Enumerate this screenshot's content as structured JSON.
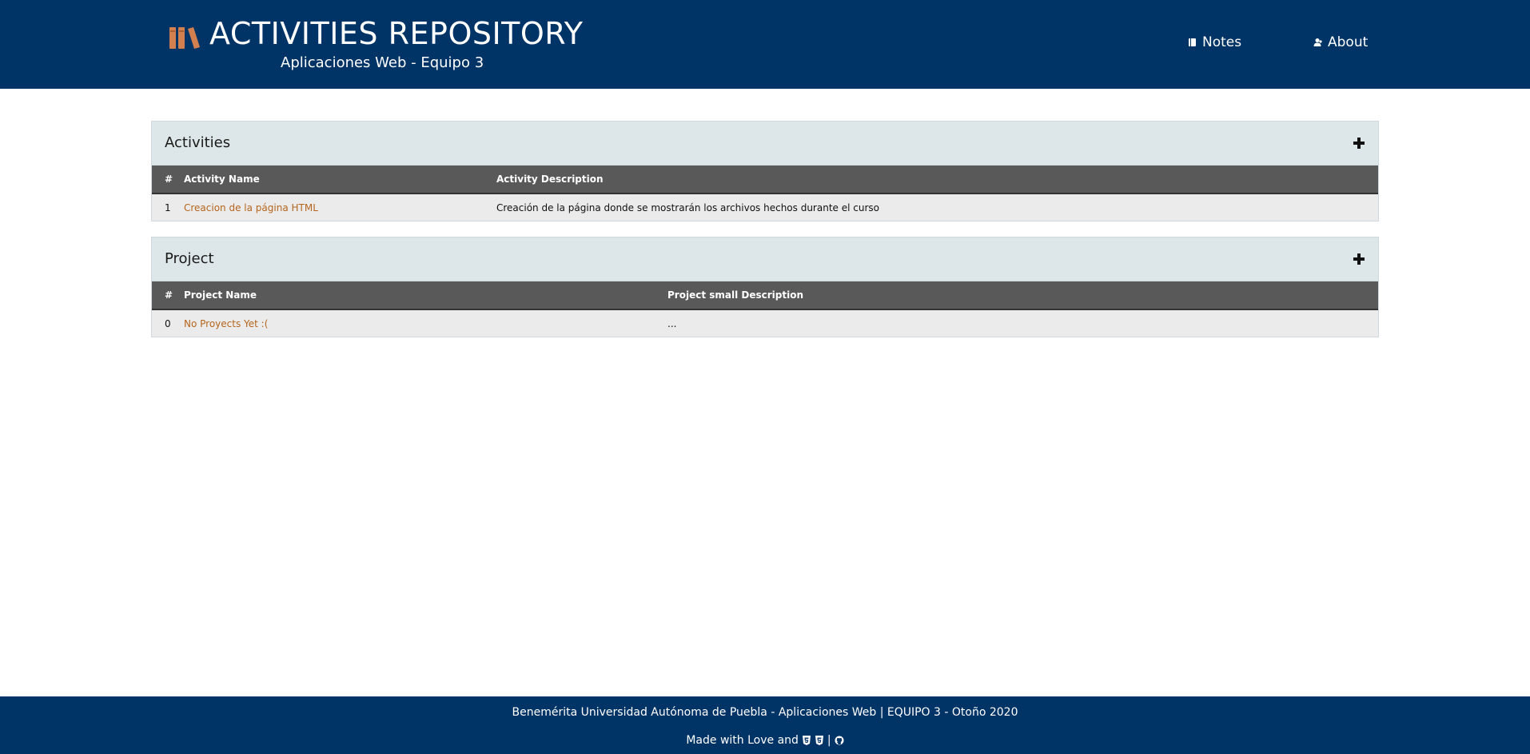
{
  "header": {
    "title": "ACTIVITIES REPOSITORY",
    "subtitle": "Aplicaciones Web - Equipo 3",
    "logo_icon": "books-icon",
    "nav": [
      {
        "label": "Notes",
        "icon": "book-icon"
      },
      {
        "label": "About",
        "icon": "users-icon"
      }
    ]
  },
  "activities": {
    "title": "Activities",
    "add_icon": "plus-icon",
    "columns": [
      "#",
      "Activity Name",
      "Activity Description"
    ],
    "rows": [
      {
        "num": "1",
        "name": "Creacion de la página HTML",
        "description": "Creación de la página donde se mostrarán los archivos hechos durante el curso"
      }
    ]
  },
  "project": {
    "title": "Project",
    "add_icon": "plus-icon",
    "columns": [
      "#",
      "Project Name",
      "Project small Description"
    ],
    "rows": [
      {
        "num": "0",
        "name": "No Proyects Yet :(",
        "description": "..."
      }
    ]
  },
  "footer": {
    "line1": "Benemérita Universidad Autónoma de Puebla - Aplicaciones Web | EQUIPO 3 - Otoño 2020",
    "made_with": "Made with Love and",
    "separator": "|",
    "icons": [
      "html5-icon",
      "css3-icon",
      "github-icon"
    ]
  },
  "colors": {
    "header_bg": "#003366",
    "accent": "#d2804f",
    "link": "#b5651d",
    "panel_head_bg": "#dde6e8",
    "table_head_bg": "#595959",
    "row_bg": "#ebebeb"
  }
}
